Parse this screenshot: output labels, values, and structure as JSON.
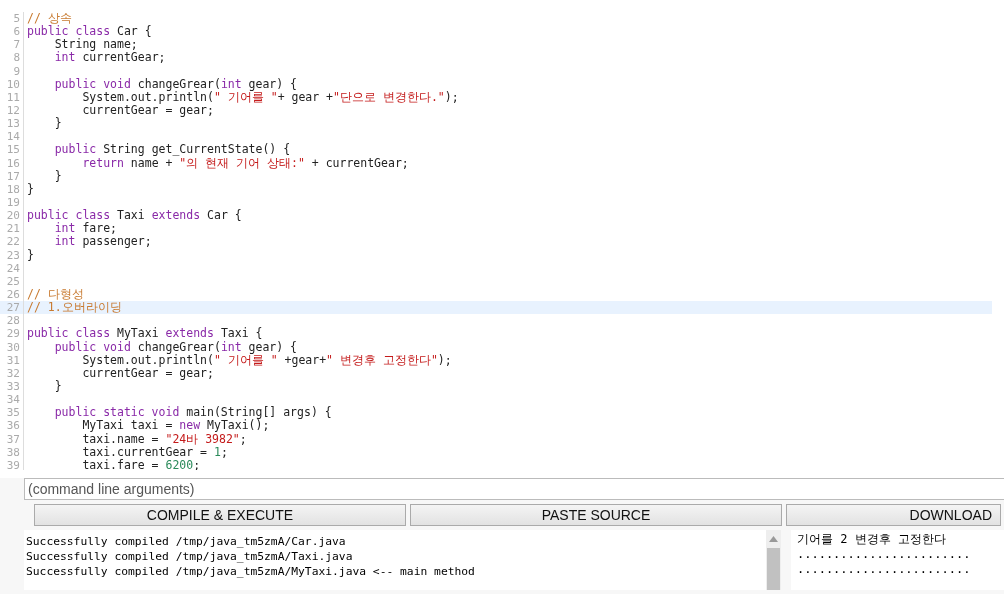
{
  "editor": {
    "lines": [
      {
        "number": "5",
        "current": false,
        "tokens": [
          {
            "kind": "comment",
            "text": "// 상속"
          }
        ]
      },
      {
        "number": "6",
        "current": false,
        "tokens": [
          {
            "kind": "keyword",
            "text": "public class"
          },
          {
            "kind": "plain",
            "text": " Car {"
          }
        ]
      },
      {
        "number": "7",
        "current": false,
        "tokens": [
          {
            "kind": "plain",
            "text": "    String name;"
          }
        ]
      },
      {
        "number": "8",
        "current": false,
        "tokens": [
          {
            "kind": "keyword",
            "text": "    int"
          },
          {
            "kind": "plain",
            "text": " currentGear;"
          }
        ]
      },
      {
        "number": "9",
        "current": false
      },
      {
        "number": "10",
        "current": false,
        "tokens": [
          {
            "kind": "keyword",
            "text": "    public void"
          },
          {
            "kind": "plain",
            "text": " changeGrear("
          },
          {
            "kind": "keyword",
            "text": "int"
          },
          {
            "kind": "plain",
            "text": " gear) {"
          }
        ]
      },
      {
        "number": "11",
        "current": false,
        "tokens": [
          {
            "kind": "plain",
            "text": "        System.out.println("
          },
          {
            "kind": "string",
            "text": "\" 기어를 \""
          },
          {
            "kind": "plain",
            "text": "+ gear +"
          },
          {
            "kind": "string",
            "text": "\"단으로 변경한다.\""
          },
          {
            "kind": "plain",
            "text": ");"
          }
        ]
      },
      {
        "number": "12",
        "current": false,
        "tokens": [
          {
            "kind": "plain",
            "text": "        currentGear = gear;"
          }
        ]
      },
      {
        "number": "13",
        "current": false,
        "tokens": [
          {
            "kind": "plain",
            "text": "    }"
          }
        ]
      },
      {
        "number": "14",
        "current": false
      },
      {
        "number": "15",
        "current": false,
        "tokens": [
          {
            "kind": "keyword",
            "text": "    public"
          },
          {
            "kind": "plain",
            "text": " String get_CurrentState() {"
          }
        ]
      },
      {
        "number": "16",
        "current": false,
        "tokens": [
          {
            "kind": "keyword",
            "text": "        return"
          },
          {
            "kind": "plain",
            "text": " name + "
          },
          {
            "kind": "string",
            "text": "\"의 현재 기어 상태:\""
          },
          {
            "kind": "plain",
            "text": " + currentGear;"
          }
        ]
      },
      {
        "number": "17",
        "current": false,
        "tokens": [
          {
            "kind": "plain",
            "text": "    }"
          }
        ]
      },
      {
        "number": "18",
        "current": false,
        "tokens": [
          {
            "kind": "plain",
            "text": "}"
          }
        ]
      },
      {
        "number": "19",
        "current": false
      },
      {
        "number": "20",
        "current": false,
        "tokens": [
          {
            "kind": "keyword",
            "text": "public class"
          },
          {
            "kind": "plain",
            "text": " Taxi "
          },
          {
            "kind": "keyword",
            "text": "extends"
          },
          {
            "kind": "plain",
            "text": " Car {"
          }
        ]
      },
      {
        "number": "21",
        "current": false,
        "tokens": [
          {
            "kind": "keyword",
            "text": "    int"
          },
          {
            "kind": "plain",
            "text": " fare;"
          }
        ]
      },
      {
        "number": "22",
        "current": false,
        "tokens": [
          {
            "kind": "keyword",
            "text": "    int"
          },
          {
            "kind": "plain",
            "text": " passenger;"
          }
        ]
      },
      {
        "number": "23",
        "current": false,
        "tokens": [
          {
            "kind": "plain",
            "text": "}"
          }
        ]
      },
      {
        "number": "24",
        "current": false
      },
      {
        "number": "25",
        "current": false
      },
      {
        "number": "26",
        "current": false,
        "tokens": [
          {
            "kind": "comment",
            "text": "// 다형성"
          }
        ]
      },
      {
        "number": "27",
        "current": true,
        "tokens": [
          {
            "kind": "comment",
            "text": "// 1.오버라이딩"
          }
        ]
      },
      {
        "number": "28",
        "current": false
      },
      {
        "number": "29",
        "current": false,
        "tokens": [
          {
            "kind": "keyword",
            "text": "public class"
          },
          {
            "kind": "plain",
            "text": " MyTaxi "
          },
          {
            "kind": "keyword",
            "text": "extends"
          },
          {
            "kind": "plain",
            "text": " Taxi {"
          }
        ]
      },
      {
        "number": "30",
        "current": false,
        "tokens": [
          {
            "kind": "keyword",
            "text": "    public void"
          },
          {
            "kind": "plain",
            "text": " changeGrear("
          },
          {
            "kind": "keyword",
            "text": "int"
          },
          {
            "kind": "plain",
            "text": " gear) {"
          }
        ]
      },
      {
        "number": "31",
        "current": false,
        "tokens": [
          {
            "kind": "plain",
            "text": "        System.out.println("
          },
          {
            "kind": "string",
            "text": "\" 기어를 \""
          },
          {
            "kind": "plain",
            "text": " +gear+"
          },
          {
            "kind": "string",
            "text": "\" 변경후 고정한다\""
          },
          {
            "kind": "plain",
            "text": ");"
          }
        ]
      },
      {
        "number": "32",
        "current": false,
        "tokens": [
          {
            "kind": "plain",
            "text": "        currentGear = gear;"
          }
        ]
      },
      {
        "number": "33",
        "current": false,
        "tokens": [
          {
            "kind": "plain",
            "text": "    }"
          }
        ]
      },
      {
        "number": "34",
        "current": false
      },
      {
        "number": "35",
        "current": false,
        "tokens": [
          {
            "kind": "keyword",
            "text": "    public static void"
          },
          {
            "kind": "plain",
            "text": " main(String[] args) {"
          }
        ]
      },
      {
        "number": "36",
        "current": false,
        "tokens": [
          {
            "kind": "plain",
            "text": "        MyTaxi taxi = "
          },
          {
            "kind": "keyword",
            "text": "new"
          },
          {
            "kind": "plain",
            "text": " MyTaxi();"
          }
        ]
      },
      {
        "number": "37",
        "current": false,
        "tokens": [
          {
            "kind": "plain",
            "text": "        taxi.name = "
          },
          {
            "kind": "string",
            "text": "\"24바 3982\""
          },
          {
            "kind": "plain",
            "text": ";"
          }
        ]
      },
      {
        "number": "38",
        "current": false,
        "tokens": [
          {
            "kind": "plain",
            "text": "        taxi.currentGear = "
          },
          {
            "kind": "number",
            "text": "1"
          },
          {
            "kind": "plain",
            "text": ";"
          }
        ]
      },
      {
        "number": "39",
        "current": false,
        "tokens": [
          {
            "kind": "plain",
            "text": "        taxi.fare = "
          },
          {
            "kind": "number",
            "text": "6200"
          },
          {
            "kind": "plain",
            "text": ";"
          }
        ]
      }
    ]
  },
  "arguments": {
    "placeholder": "(command line arguments)"
  },
  "buttons": [
    "COMPILE & EXECUTE",
    "PASTE SOURCE",
    "DOWNLOAD"
  ],
  "compile_log": [
    "Successfully compiled /tmp/java_tm5zmA/Car.java",
    "Successfully compiled /tmp/java_tm5zmA/Taxi.java",
    "Successfully compiled /tmp/java_tm5zmA/MyTaxi.java <-- main method"
  ],
  "program_output": [
    "기어를 2 변경후 고정한다",
    "........................",
    "........................"
  ]
}
